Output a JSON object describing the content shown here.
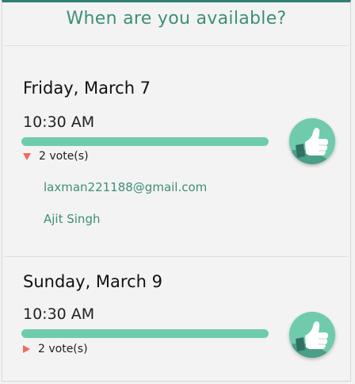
{
  "header": {
    "title": "When are you available?"
  },
  "slots": [
    {
      "day": "Friday, March 7",
      "time": "10:30 AM",
      "votes_label": "2 vote(s)",
      "vote_fraction": 1.0,
      "expanded": true,
      "voters": [
        "laxman221188@gmail.com",
        "Ajit Singh"
      ]
    },
    {
      "day": "Sunday, March 9",
      "time": "10:30 AM",
      "votes_label": "2 vote(s)",
      "vote_fraction": 1.0,
      "expanded": false,
      "voters": []
    }
  ],
  "icons": {
    "vote_button": "thumbs-up-icon",
    "expand_open": "triangle-down-icon",
    "expand_closed": "triangle-right-icon"
  },
  "colors": {
    "accent": "#3e8e79",
    "bar": "#6fcbab",
    "triangle": "#f06a5f"
  }
}
